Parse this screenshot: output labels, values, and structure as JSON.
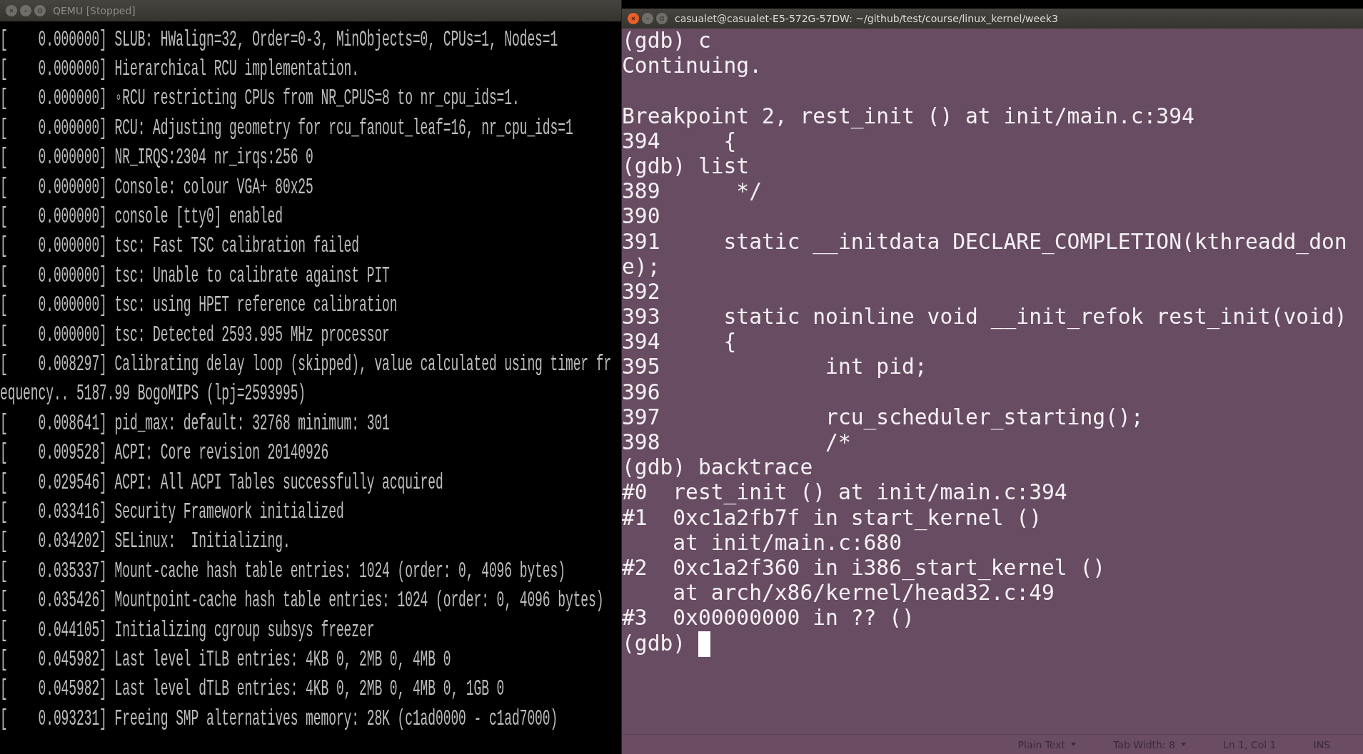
{
  "qemu_window": {
    "title": "QEMU [Stopped]",
    "focused": false,
    "lines": [
      "[    0.000000] SLUB: HWalign=32, Order=0-3, MinObjects=0, CPUs=1, Nodes=1",
      "[    0.000000] Hierarchical RCU implementation.",
      "[    0.000000] ◦RCU restricting CPUs from NR_CPUS=8 to nr_cpu_ids=1.",
      "[    0.000000] RCU: Adjusting geometry for rcu_fanout_leaf=16, nr_cpu_ids=1",
      "[    0.000000] NR_IRQS:2304 nr_irqs:256 0",
      "[    0.000000] Console: colour VGA+ 80x25",
      "[    0.000000] console [tty0] enabled",
      "[    0.000000] tsc: Fast TSC calibration failed",
      "[    0.000000] tsc: Unable to calibrate against PIT",
      "[    0.000000] tsc: using HPET reference calibration",
      "[    0.000000] tsc: Detected 2593.995 MHz processor",
      "[    0.008297] Calibrating delay loop (skipped), value calculated using timer fr",
      "equency.. 5187.99 BogoMIPS (lpj=2593995)",
      "[    0.008641] pid_max: default: 32768 minimum: 301",
      "[    0.009528] ACPI: Core revision 20140926",
      "[    0.029546] ACPI: All ACPI Tables successfully acquired",
      "[    0.033416] Security Framework initialized",
      "[    0.034202] SELinux:  Initializing.",
      "[    0.035337] Mount-cache hash table entries: 1024 (order: 0, 4096 bytes)",
      "[    0.035426] Mountpoint-cache hash table entries: 1024 (order: 0, 4096 bytes)",
      "[    0.044105] Initializing cgroup subsys freezer",
      "[    0.045982] Last level iTLB entries: 4KB 0, 2MB 0, 4MB 0",
      "[    0.045982] Last level dTLB entries: 4KB 0, 2MB 0, 4MB 0, 1GB 0",
      "[    0.093231] Freeing SMP alternatives memory: 28K (c1ad0000 - c1ad7000)"
    ]
  },
  "terminal_window": {
    "title": "casualet@casualet-E5-572G-57DW: ~/github/test/course/linux_kernel/week3",
    "focused": true,
    "blocks": [
      [
        "(gdb) c",
        "Continuing."
      ],
      [
        "Breakpoint 2, rest_init () at init/main.c:394",
        "394\t{",
        "(gdb) list",
        "389\t */",
        "390",
        "391\tstatic __initdata DECLARE_COMPLETION(kthreadd_don",
        "e);",
        "392",
        "393\tstatic noinline void __init_refok rest_init(void)",
        "394\t{",
        "395\t\tint pid;",
        "396",
        "397\t\trcu_scheduler_starting();",
        "398\t\t/*",
        "(gdb) backtrace",
        "#0  rest_init () at init/main.c:394",
        "#1  0xc1a2fb7f in start_kernel ()",
        "    at init/main.c:680",
        "#2  0xc1a2f360 in i386_start_kernel ()",
        "    at arch/x86/kernel/head32.c:49",
        "#3  0x00000000 in ?? ()",
        "(gdb) "
      ]
    ]
  },
  "status_bar": {
    "items": [
      {
        "kind": "dropdown",
        "label": "Plain Text"
      },
      {
        "kind": "dropdown",
        "label": "Tab Width: 8"
      },
      {
        "kind": "text",
        "label": "Ln 1, Col 1"
      },
      {
        "kind": "text",
        "label": "INS"
      }
    ]
  }
}
